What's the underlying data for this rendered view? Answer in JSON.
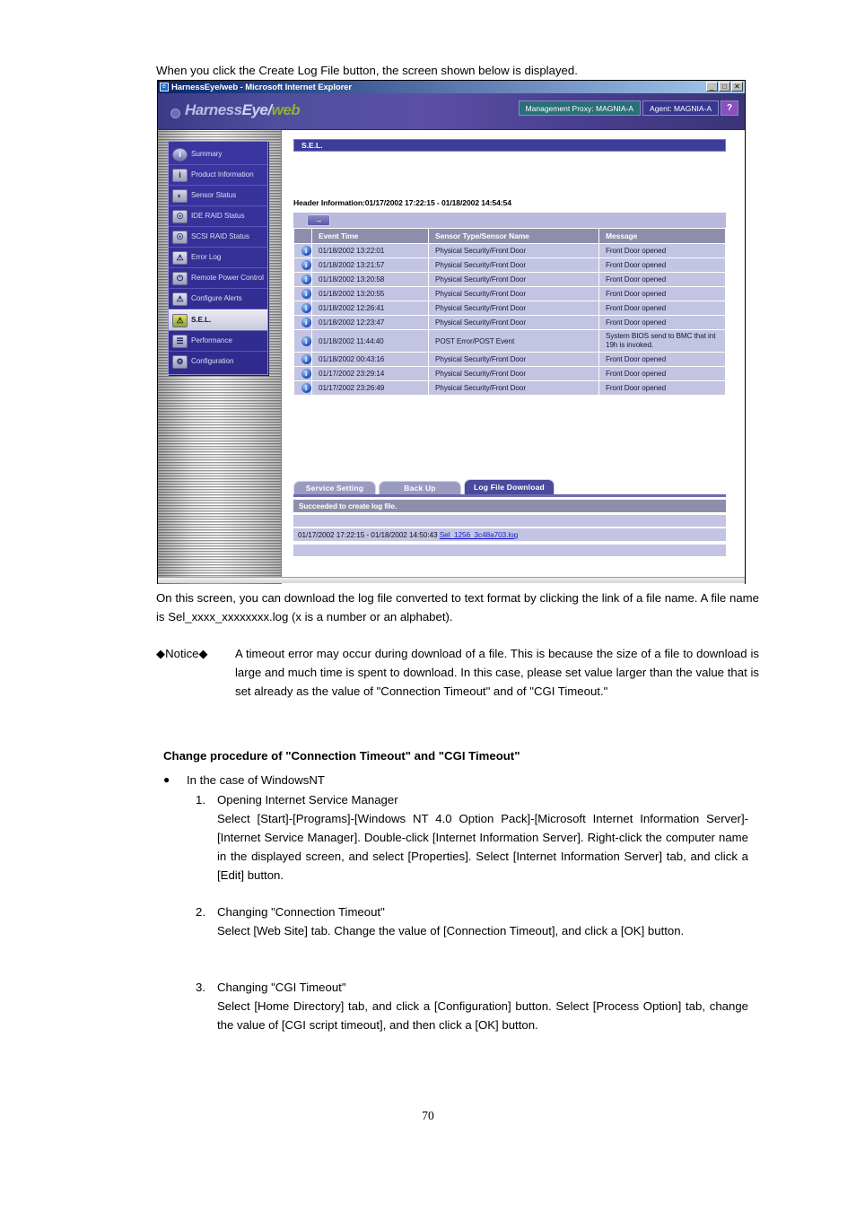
{
  "document": {
    "intro": "When you click the Create Log File button, the screen shown below is displayed.",
    "below_para": "On this screen, you can download the log file converted to text format by clicking the link of a file name. A file name is Sel_xxxx_xxxxxxxx.log (x is a number or an alphabet).",
    "notice_label": "◆Notice◆",
    "notice_body": "A timeout error may occur during download of a file. This is because the size of a file to download is large and much time is spent to download. In this case, please set value larger than the value that is set already as the value of \"Connection Timeout\" and of \"CGI Timeout.\"",
    "heading": "Change procedure of \"Connection Timeout\" and \"CGI Timeout\"",
    "bullet_dot": "●",
    "bullet_text": "In the case of WindowsNT",
    "steps": [
      {
        "index": "1.",
        "title": "Opening Internet Service Manager",
        "body": "Select [Start]-[Programs]-[Windows NT 4.0 Option Pack]-[Microsoft Internet Information Server]-[Internet Service Manager]. Double-click [Internet Information Server]. Right-click the computer name in the displayed screen, and select [Properties]. Select [Internet Information Server] tab, and click a [Edit] button."
      },
      {
        "index": "2.",
        "title": "Changing \"Connection Timeout\"",
        "body": "Select [Web Site] tab. Change the value of [Connection Timeout], and click a [OK] button."
      },
      {
        "index": "3.",
        "title": "Changing \"CGI Timeout\"",
        "body": "Select [Home Directory] tab, and click a [Configuration] button. Select [Process Option] tab, change the value of [CGI script timeout], and then click a [OK] button."
      }
    ],
    "page_number": "70"
  },
  "browser": {
    "titlebar": {
      "icon": "ie-icon",
      "title": "HarnessEye/web - Microsoft Internet Explorer",
      "minimize": "_",
      "maximize": "□",
      "close": "✕"
    },
    "banner": {
      "logo_part1": "Harness",
      "logo_part2": "Eye/",
      "logo_part3": "web",
      "buttons": [
        {
          "label": "Management Proxy: MAGNIA-A",
          "style": "teal"
        },
        {
          "label": "Agent: MAGNIA-A",
          "style": "navy"
        }
      ],
      "help_label": "?"
    },
    "sidebar": {
      "items": [
        {
          "label": "Summary",
          "icon": "info-icon",
          "selected": false
        },
        {
          "label": "Product Information",
          "icon": "product-info-icon",
          "selected": false
        },
        {
          "label": "Sensor Status",
          "icon": "sensor-icon",
          "selected": false
        },
        {
          "label": "IDE RAID Status",
          "icon": "ide-raid-icon",
          "selected": false
        },
        {
          "label": "SCSI RAID Status",
          "icon": "scsi-raid-icon",
          "selected": false
        },
        {
          "label": "Error Log",
          "icon": "error-log-icon",
          "selected": false
        },
        {
          "label": "Remote Power Control",
          "icon": "remote-power-icon",
          "selected": false
        },
        {
          "label": "Configure Alerts",
          "icon": "configure-alerts-icon",
          "selected": false
        },
        {
          "label": "S.E.L.",
          "icon": "sel-icon",
          "selected": true
        },
        {
          "label": "Performance",
          "icon": "performance-icon",
          "selected": false
        },
        {
          "label": "Configuration",
          "icon": "configuration-icon",
          "selected": false
        }
      ]
    },
    "main": {
      "section_title": "S.E.L.",
      "header_information": "Header Information:01/17/2002 17:22:15 - 01/18/2002 14:54:54",
      "next_button": "→",
      "table": {
        "columns": [
          "Event Time",
          "Sensor Type/Sensor Name",
          "Message"
        ],
        "rows": [
          {
            "icon": "info-icon",
            "time": "01/18/2002 13:22:01",
            "sensor": "Physical Security/Front Door",
            "message": "Front Door opened"
          },
          {
            "icon": "info-icon",
            "time": "01/18/2002 13:21:57",
            "sensor": "Physical Security/Front Door",
            "message": "Front Door opened"
          },
          {
            "icon": "info-icon",
            "time": "01/18/2002 13:20:58",
            "sensor": "Physical Security/Front Door",
            "message": "Front Door opened"
          },
          {
            "icon": "info-icon",
            "time": "01/18/2002 13:20:55",
            "sensor": "Physical Security/Front Door",
            "message": "Front Door opened"
          },
          {
            "icon": "info-icon",
            "time": "01/18/2002 12:26:41",
            "sensor": "Physical Security/Front Door",
            "message": "Front Door opened"
          },
          {
            "icon": "info-icon",
            "time": "01/18/2002 12:23:47",
            "sensor": "Physical Security/Front Door",
            "message": "Front Door opened"
          },
          {
            "icon": "info-icon",
            "time": "01/18/2002 11:44:40",
            "sensor": "POST Error/POST Event",
            "message": "System BIOS send to BMC that int 19h is invoked."
          },
          {
            "icon": "info-icon",
            "time": "01/18/2002 00:43:16",
            "sensor": "Physical Security/Front Door",
            "message": "Front Door opened"
          },
          {
            "icon": "info-icon",
            "time": "01/17/2002 23:29:14",
            "sensor": "Physical Security/Front Door",
            "message": "Front Door opened"
          },
          {
            "icon": "info-icon",
            "time": "01/17/2002 23:26:49",
            "sensor": "Physical Security/Front Door",
            "message": "Front Door opened"
          }
        ]
      },
      "tabs": [
        {
          "label": "Service Setting",
          "active": false
        },
        {
          "label": "Back Up",
          "active": false
        },
        {
          "label": "Log File Download",
          "active": true
        }
      ],
      "status_message": "Succeeded to create log file.",
      "file_row": {
        "range": "01/17/2002 17:22:15 - 01/18/2002 14:50:43",
        "link": "Sel_1256_3c48a703.log"
      }
    }
  }
}
